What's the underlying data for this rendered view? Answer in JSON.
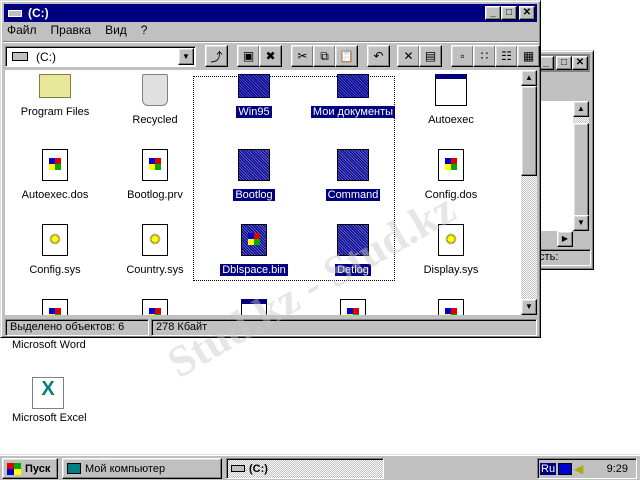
{
  "window": {
    "title": "(C:)",
    "menu": [
      "Файл",
      "Правка",
      "Вид",
      "?"
    ],
    "address": "(C:)"
  },
  "toolbar": [
    "up-folder",
    "map-drive",
    "disconnect-drive",
    "cut",
    "copy",
    "paste",
    "undo",
    "delete",
    "properties",
    "large-icons",
    "small-icons",
    "list",
    "details"
  ],
  "items": [
    {
      "label": "Program Files",
      "icon": "folder",
      "selected": false
    },
    {
      "label": "Recycled",
      "icon": "recycle-bin",
      "selected": false
    },
    {
      "label": "Win95",
      "icon": "folder",
      "selected": true
    },
    {
      "label": "Мои документы",
      "icon": "folder",
      "selected": true
    },
    {
      "label": "Autoexec",
      "icon": "app-window",
      "selected": false
    },
    {
      "label": "Autoexec.dos",
      "icon": "document",
      "selected": false
    },
    {
      "label": "Bootlog.prv",
      "icon": "document",
      "selected": false
    },
    {
      "label": "Bootlog",
      "icon": "notepad",
      "selected": true
    },
    {
      "label": "Command",
      "icon": "app-window",
      "selected": true
    },
    {
      "label": "Config.dos",
      "icon": "document",
      "selected": false
    },
    {
      "label": "Config.sys",
      "icon": "settings-file",
      "selected": false
    },
    {
      "label": "Country.sys",
      "icon": "settings-file",
      "selected": false
    },
    {
      "label": "Dblspace.bin",
      "icon": "document",
      "selected": true
    },
    {
      "label": "Detlog",
      "icon": "notepad",
      "selected": true
    },
    {
      "label": "Display.sys",
      "icon": "settings-file",
      "selected": false
    }
  ],
  "status": {
    "selected": "Выделено объектов: 6",
    "size": "278 Кбайт"
  },
  "back_window": {
    "status_fragment": "кость:"
  },
  "desktop": [
    "Microsoft Word",
    "Microsoft Excel"
  ],
  "watermark": "Stud.kz - Stud.kz",
  "taskbar": {
    "start": "Пуск",
    "tasks": [
      "Мой компьютер",
      "(C:)"
    ],
    "lang": "Ru",
    "clock": "9:29"
  }
}
